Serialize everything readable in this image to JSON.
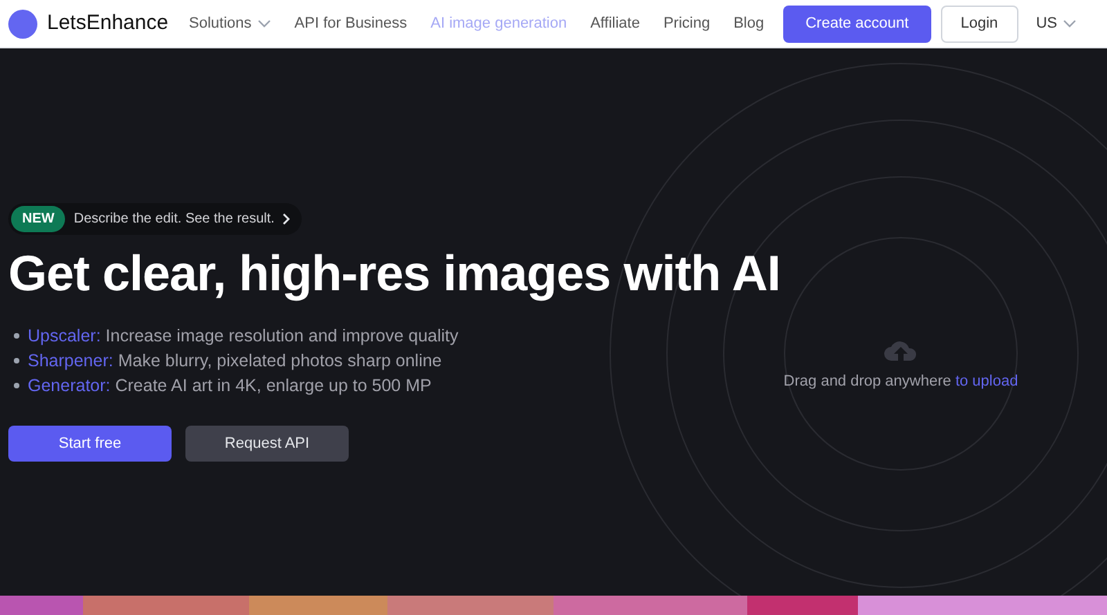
{
  "header": {
    "brand": "LetsEnhance",
    "nav": [
      {
        "label": "Solutions",
        "selected": false,
        "dropdown": true
      },
      {
        "label": "API for Business",
        "selected": false,
        "dropdown": false
      },
      {
        "label": "AI image generation",
        "selected": true,
        "dropdown": false
      },
      {
        "label": "Affiliate",
        "selected": false,
        "dropdown": false
      },
      {
        "label": "Pricing",
        "selected": false,
        "dropdown": false
      },
      {
        "label": "Blog",
        "selected": false,
        "dropdown": false
      }
    ],
    "create_account": "Create account",
    "login": "Login",
    "locale": "US"
  },
  "hero": {
    "badge": "NEW",
    "announcement": "Describe the edit. See the result.",
    "title": "Get clear, high-res images with AI",
    "features": [
      {
        "name": "Upscaler:",
        "text": "Increase image resolution and improve quality"
      },
      {
        "name": "Sharpener:",
        "text": "Make blurry, pixelated photos sharp online"
      },
      {
        "name": "Generator:",
        "text": "Create AI art in 4K, enlarge up to 500 MP"
      }
    ],
    "buttons": [
      {
        "label": "Start free",
        "kind": "primary"
      },
      {
        "label": "Request API",
        "kind": "secondary"
      }
    ]
  },
  "upload": {
    "text": "Drag and drop anywhere",
    "link": "to upload"
  }
}
